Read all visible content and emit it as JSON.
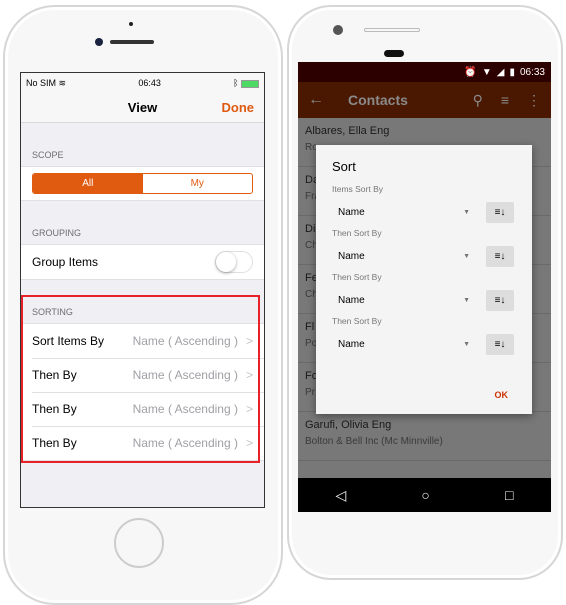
{
  "ios": {
    "status": {
      "carrier": "No SIM",
      "time": "06:43"
    },
    "nav": {
      "title": "View",
      "done": "Done"
    },
    "scope": {
      "header": "SCOPE",
      "options": [
        "All",
        "My"
      ],
      "selected": "All"
    },
    "grouping": {
      "header": "GROUPING",
      "label": "Group Items",
      "on": false
    },
    "sorting": {
      "header": "SORTING",
      "rows": [
        {
          "label": "Sort Items By",
          "value": "Name ( Ascending )"
        },
        {
          "label": "Then By",
          "value": "Name ( Ascending )"
        },
        {
          "label": "Then By",
          "value": "Name ( Ascending )"
        },
        {
          "label": "Then By",
          "value": "Name ( Ascending )"
        }
      ]
    },
    "accent": "#e05a10",
    "highlight": "#e8202a"
  },
  "android": {
    "status": {
      "time": "06:33"
    },
    "toolbar": {
      "title": "Contacts"
    },
    "list": [
      {
        "name": "Albares, Ella Eng",
        "sub": "Ro"
      },
      {
        "name": "Da",
        "sub": "Fra"
      },
      {
        "name": "Di",
        "sub": "Ch"
      },
      {
        "name": "Fe",
        "sub": "Ch"
      },
      {
        "name": "Fl",
        "sub": "Po"
      },
      {
        "name": "Fo",
        "sub": "Pr"
      },
      {
        "name": "Garufi, Olivia Eng",
        "sub": "Bolton & Bell Inc (Mc Minnville)"
      }
    ],
    "dialog": {
      "title": "Sort",
      "groups": [
        {
          "label": "Items Sort By",
          "value": "Name",
          "order": "ascending"
        },
        {
          "label": "Then Sort By",
          "value": "Name",
          "order": "descending"
        },
        {
          "label": "Then Sort By",
          "value": "Name",
          "order": "ascending"
        },
        {
          "label": "Then Sort By",
          "value": "Name",
          "order": "ascending"
        }
      ],
      "ok": "OK"
    }
  }
}
